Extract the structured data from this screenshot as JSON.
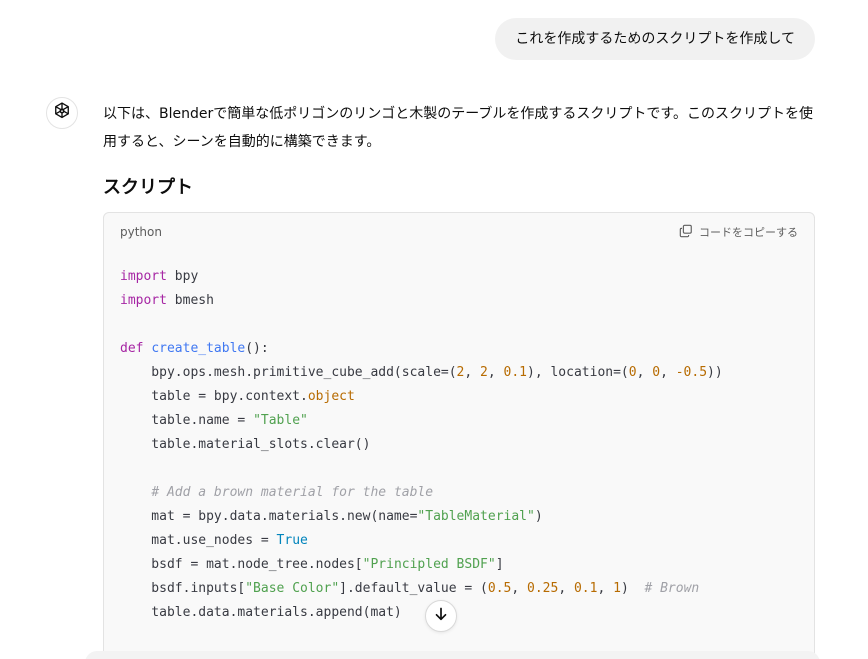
{
  "user_message": {
    "text": "これを作成するためのスクリプトを作成して"
  },
  "assistant": {
    "avatar_icon": "openai-logo-icon",
    "intro": "以下は、Blenderで簡単な低ポリゴンのリンゴと木製のテーブルを作成するスクリプトです。このスクリプトを使用すると、シーンを自動的に構築できます。",
    "section_heading": "スクリプト"
  },
  "code_block": {
    "language": "python",
    "copy_label": "コードをコピーする",
    "copy_icon": "copy-icon",
    "lines": [
      "import bpy",
      "import bmesh",
      "",
      "def create_table():",
      "    bpy.ops.mesh.primitive_cube_add(scale=(2, 2, 0.1), location=(0, 0, -0.5))",
      "    table = bpy.context.object",
      "    table.name = \"Table\"",
      "    table.material_slots.clear()",
      "",
      "    # Add a brown material for the table",
      "    mat = bpy.data.materials.new(name=\"TableMaterial\")",
      "    mat.use_nodes = True",
      "    bsdf = mat.node_tree.nodes[\"Principled BSDF\"]",
      "    bsdf.inputs[\"Base Color\"].default_value = (0.5, 0.25, 0.1, 1)  # Brown",
      "    table.data.materials.append(mat)"
    ]
  },
  "scroll_button": {
    "icon": "arrow-down-icon"
  },
  "colors": {
    "keyword": "#a626a4",
    "function": "#4078f2",
    "number": "#b76b01",
    "string": "#50a14f",
    "comment": "#a0a1a7",
    "boolean": "#0184bc",
    "bubble": "#f1f1f1",
    "code_bg": "#f9f9f9"
  }
}
